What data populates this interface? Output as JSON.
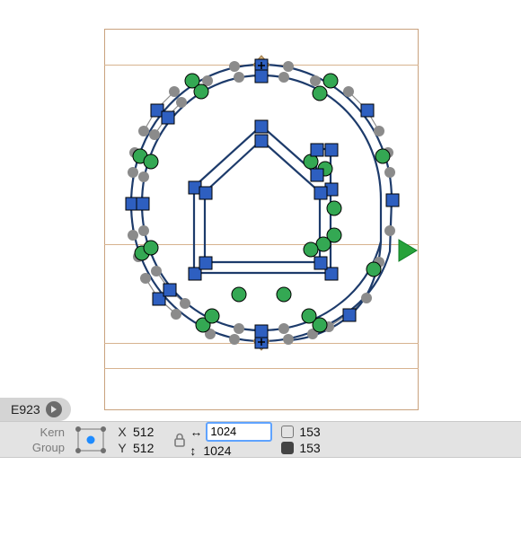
{
  "glyph": {
    "unicode": "E923"
  },
  "panel": {
    "kern_label": "Kern",
    "group_label": "Group",
    "x_label": "X",
    "y_label": "Y",
    "x_value": "512",
    "y_value": "512",
    "width_value": "1024",
    "height_value": "1024",
    "lsb_value": "153",
    "rsb_value": "153"
  },
  "icons": {
    "unicode_chip_arrow": "arrow-right-circle-icon",
    "lock": "lock-icon",
    "width_arrow": "↔",
    "height_arrow": "↕"
  }
}
